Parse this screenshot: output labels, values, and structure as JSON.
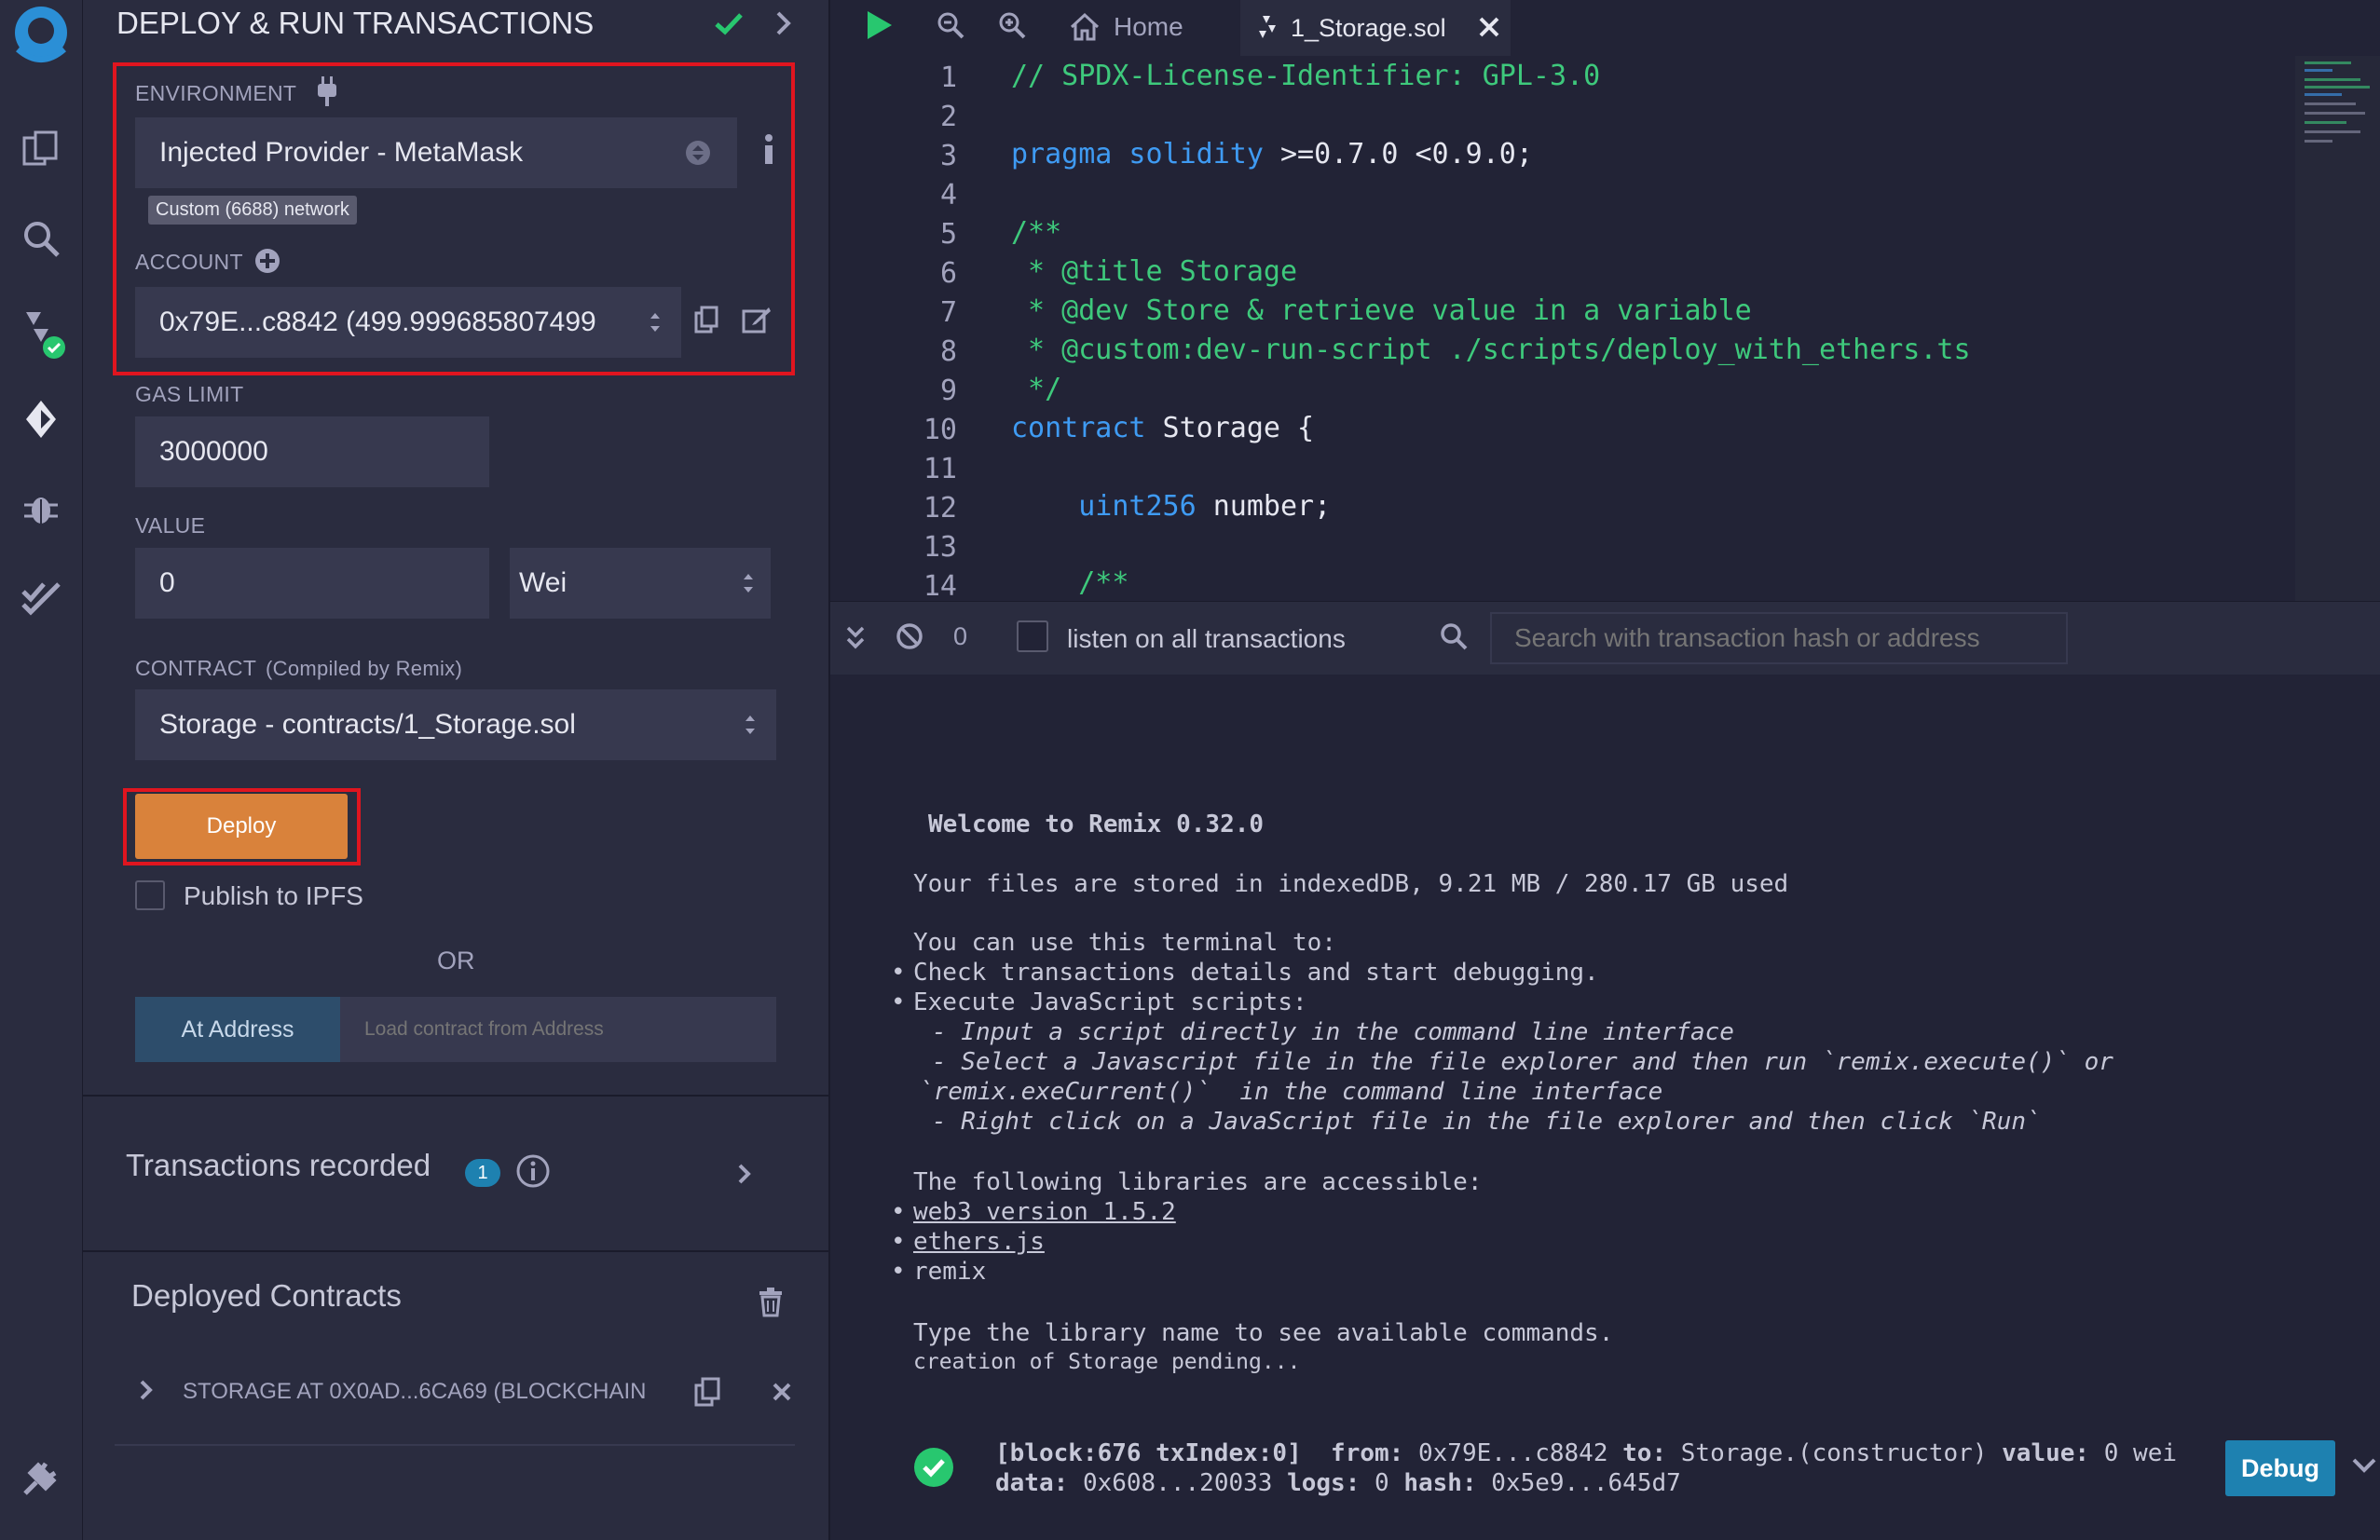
{
  "panel": {
    "title": "DEPLOY & RUN TRANSACTIONS",
    "environment": {
      "label": "ENVIRONMENT",
      "value": "Injected Provider - MetaMask",
      "network_badge": "Custom (6688) network"
    },
    "account": {
      "label": "ACCOUNT",
      "value": "0x79E...c8842 (499.999685807499"
    },
    "gas_limit": {
      "label": "GAS LIMIT",
      "value": "3000000"
    },
    "value": {
      "label": "VALUE",
      "amount": "0",
      "unit": "Wei"
    },
    "contract": {
      "label": "CONTRACT",
      "sublabel": "(Compiled by Remix)",
      "value": "Storage - contracts/1_Storage.sol"
    },
    "deploy_label": "Deploy",
    "publish_ipfs_label": "Publish to IPFS",
    "or_label": "OR",
    "at_address_label": "At Address",
    "load_placeholder": "Load contract from Address",
    "transactions_recorded": {
      "label": "Transactions recorded",
      "count": "1"
    },
    "deployed_contracts": {
      "label": "Deployed Contracts",
      "items": [
        {
          "label": "STORAGE AT 0X0AD...6CA69 (BLOCKCHAIN"
        }
      ]
    }
  },
  "tabs": {
    "home": "Home",
    "file": "1_Storage.sol"
  },
  "editor": {
    "line_numbers": [
      "1",
      "2",
      "3",
      "4",
      "5",
      "6",
      "7",
      "8",
      "9",
      "10",
      "11",
      "12",
      "13",
      "14"
    ],
    "lines": {
      "l1": "// SPDX-License-Identifier: GPL-3.0",
      "l3_kw": "pragma solidity",
      "l3_rest": " >=0.7.0 <0.9.0;",
      "l5": "/**",
      "l6": " * @title Storage",
      "l7": " * @dev Store & retrieve value in a variable",
      "l8": " * @custom:dev-run-script ./scripts/deploy_with_ethers.ts",
      "l9": " */",
      "l10_kw": "contract",
      "l10_rest": " Storage {",
      "l12_kw": "    uint256",
      "l12_rest": " number;",
      "l14": "    /**"
    }
  },
  "terminal_bar": {
    "count": "0",
    "listen_label": "listen on all transactions",
    "search_placeholder": "Search with transaction hash or address"
  },
  "terminal": {
    "welcome": "Welcome to Remix 0.32.0",
    "storage": "Your files are stored in indexedDB, 9.21 MB / 280.17 GB used",
    "use_intro": "You can use this terminal to:",
    "bullet1": "Check transactions details and start debugging.",
    "bullet2": "Execute JavaScript scripts:",
    "sub1": "- Input a script directly in the command line interface",
    "sub2": "- Select a Javascript file in the file explorer and then run `remix.execute()` or",
    "sub2b": "`remix.exeCurrent()`  in the command line interface",
    "sub3": "- Right click on a JavaScript file in the file explorer and then click `Run`",
    "libs_intro": "The following libraries are accessible:",
    "lib1": "web3 version 1.5.2",
    "lib2": "ethers.js",
    "lib3": "remix",
    "type_hint": "Type the library name to see available commands.",
    "pending": "creation of Storage pending...",
    "tx_line1_block": "[block:676 txIndex:0]",
    "tx_from_label": "from:",
    "tx_from": "0x79E...c8842",
    "tx_to_label": "to:",
    "tx_to": "Storage.(constructor)",
    "tx_value_label": "value:",
    "tx_value": "0 wei",
    "tx_data_label": "data:",
    "tx_data": "0x608...20033",
    "tx_logs_label": "logs:",
    "tx_logs": "0",
    "tx_hash_label": "hash:",
    "tx_hash": "0x5e9...645d7",
    "debug_label": "Debug"
  },
  "colors": {
    "deploy": "#d9823b",
    "highlight": "#e0151f",
    "accent_blue": "#1e81b0",
    "success": "#28c76f"
  }
}
